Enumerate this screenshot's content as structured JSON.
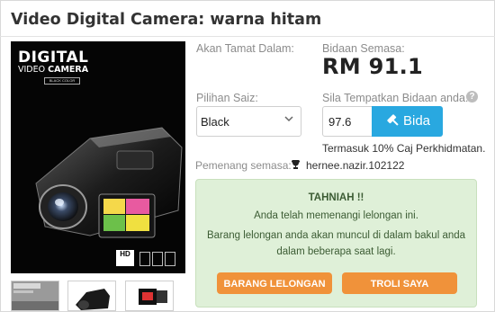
{
  "product": {
    "title": "Video Digital Camera: warna hitam",
    "image_brand": "DIGITAL",
    "image_subtitle_light": "VIDEO",
    "image_subtitle_bold": "CAMERA",
    "image_tag": "BLACK COLOR",
    "image_hd": "HD"
  },
  "auction": {
    "ends_label": "Akan Tamat Dalam:",
    "current_bid_label": "Bidaan Semasa:",
    "current_bid": "RM 91.1",
    "size_label": "Pilihan Saiz:",
    "size_value": "Black",
    "place_bid_label": "Sila Tempatkan Bidaan anda:",
    "bid_input_value": "97.6",
    "bid_button": "Bida",
    "help_icon": "?",
    "charge_note": "Termasuk 10% Caj Perkhidmatan.",
    "winner_label": "Pemenang semasa:",
    "winner_name": "hernee.nazir.102122"
  },
  "notice": {
    "title": "TAHNIAH !!",
    "line1": "Anda telah memenangi lelongan ini.",
    "line2": "Barang lelongan anda akan muncul di dalam bakul anda",
    "line3": "dalam beberapa saat lagi.",
    "button_items": "BARANG LELONGAN",
    "button_cart": "TROLI SAYA"
  },
  "icons": {
    "chevron": "chevron-down-icon",
    "gavel": "gavel-icon",
    "trophy": "trophy-icon",
    "help": "help-icon"
  },
  "colors": {
    "bid_button": "#29a8e0",
    "notice_bg": "#dff0d8",
    "notice_text": "#3c5c34",
    "action_button": "#f0923a"
  }
}
